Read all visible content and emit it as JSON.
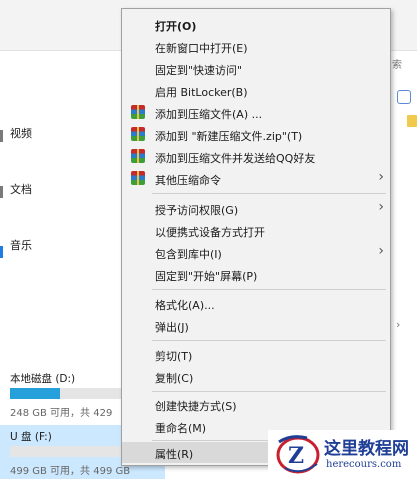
{
  "explorer": {
    "search_fragment": "索",
    "scroll_arrow": "›",
    "nav": [
      {
        "label": "视频"
      },
      {
        "label": "文档"
      },
      {
        "label": "音乐"
      }
    ],
    "drives": [
      {
        "name": "本地磁盘 (D:)",
        "info": "248 GB 可用，共 429",
        "used_fraction": 0.42,
        "color": "#26a0da"
      },
      {
        "name": "U 盘 (F:)",
        "info": "499 GB 可用，共 499 GB",
        "used_fraction": 0.0,
        "color": "#26a0da"
      }
    ]
  },
  "context_menu": {
    "items": [
      {
        "label": "打开(O)",
        "bold": true
      },
      {
        "label": "在新窗口中打开(E)"
      },
      {
        "label": "固定到\"快速访问\""
      },
      {
        "label": "启用 BitLocker(B)"
      },
      {
        "label": "添加到压缩文件(A) ...",
        "icon": "winrar-icon"
      },
      {
        "label": "添加到 \"新建压缩文件.zip\"(T)",
        "icon": "winrar-icon"
      },
      {
        "label": "添加到压缩文件并发送给QQ好友",
        "icon": "winrar-icon"
      },
      {
        "label": "其他压缩命令",
        "icon": "winrar-icon",
        "submenu": true
      },
      {
        "label": "授予访问权限(G)",
        "submenu": true
      },
      {
        "label": "以便携式设备方式打开"
      },
      {
        "label": "包含到库中(I)",
        "submenu": true
      },
      {
        "label": "固定到\"开始\"屏幕(P)"
      },
      {
        "label": "格式化(A)..."
      },
      {
        "label": "弹出(J)"
      },
      {
        "label": "剪切(T)"
      },
      {
        "label": "复制(C)"
      },
      {
        "label": "创建快捷方式(S)"
      },
      {
        "label": "重命名(M)"
      },
      {
        "label": "属性(R)",
        "hovered": true
      }
    ],
    "submenu_arrow": "›"
  },
  "watermark": {
    "title": "这里教程网",
    "url": "herecours.com",
    "logo_letter": "Z"
  },
  "colors": {
    "menu_bg": "#f2f2f2",
    "hover": "#d9d9d9",
    "drive_selected_bg": "#cce8ff",
    "progress": "#26a0da",
    "watermark_blue": "#1f3f96",
    "watermark_red": "#c8202f"
  }
}
